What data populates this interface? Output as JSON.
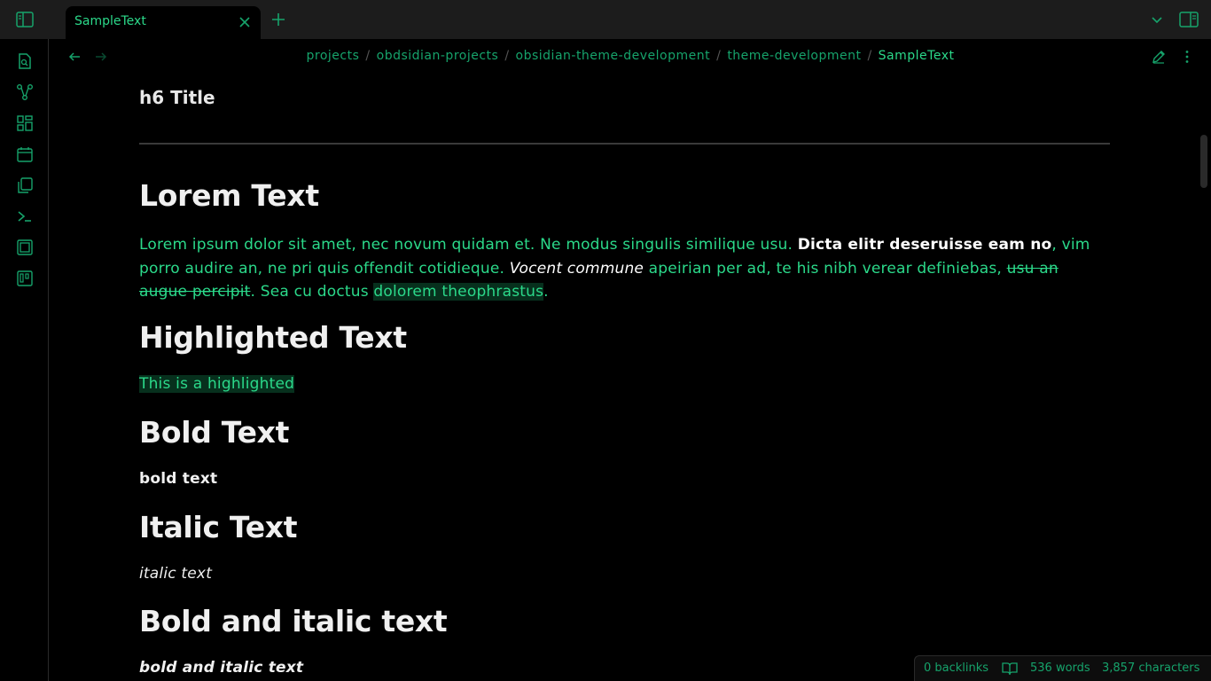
{
  "colors": {
    "accent": "#2bd98a",
    "accent_dim": "#16a36b",
    "background": "#000000",
    "highlight_bg": "#07301d"
  },
  "titlebar": {
    "tab_label": "SampleText",
    "icons": [
      "sidebar-left-icon",
      "close-icon",
      "plus-icon",
      "chevron-down-icon",
      "sidebar-right-icon"
    ]
  },
  "ribbon": {
    "icons": [
      "file-search-icon",
      "graph-icon",
      "grid-icon",
      "calendar-icon",
      "copy-icon",
      "terminal-icon",
      "stacked-pages-icon",
      "kanban-icon"
    ]
  },
  "header": {
    "breadcrumb": [
      "projects",
      "obdsidian-projects",
      "obsidian-theme-development",
      "theme-development"
    ],
    "current": "SampleText",
    "separator": "/"
  },
  "content": {
    "h6_title": "h6 Title",
    "lorem": {
      "heading": "Lorem Text",
      "p1": "Lorem ipsum dolor sit amet, nec novum quidam et. Ne modus singulis similique usu. ",
      "bold": "Dicta elitr deseruisse eam no",
      "p2": ", vim porro audire an, ne pri quis offendit cotidieque. ",
      "italic": "Vocent commune",
      "p3": " apeirian per ad, te his nibh verear definiebas, ",
      "strike": "usu an augue percipit",
      "p4": ". Sea cu doctus ",
      "mark": "dolorem theophrastus",
      "p5": "."
    },
    "highlighted": {
      "heading": "Highlighted Text",
      "text": "This is a highlighted"
    },
    "bold": {
      "heading": "Bold Text",
      "text": "bold text"
    },
    "italic": {
      "heading": "Italic Text",
      "text": "italic text"
    },
    "bold_italic": {
      "heading": "Bold and italic text",
      "text": "bold and italic text"
    }
  },
  "statusbar": {
    "backlinks": "0 backlinks",
    "words": "536 words",
    "characters": "3,857 characters"
  }
}
